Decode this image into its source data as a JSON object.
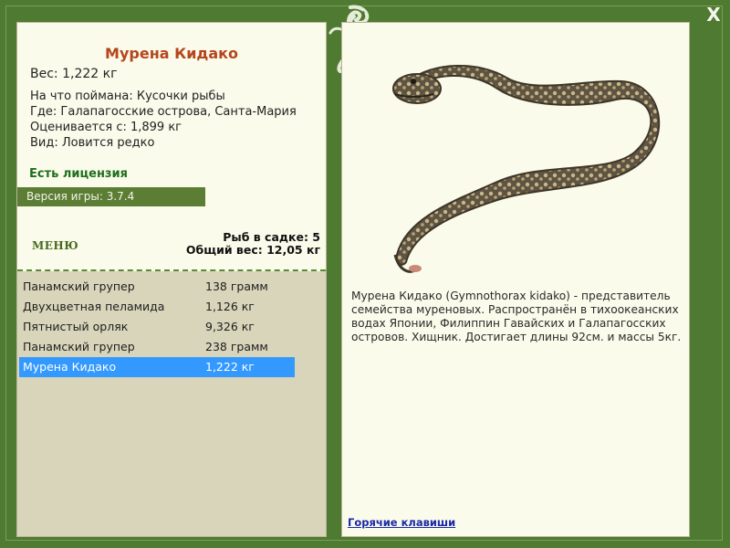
{
  "window": {
    "close_label": "X"
  },
  "fish": {
    "title": "Мурена Кидако",
    "weight_line": "Вес: 1,222 кг",
    "bait_line": "На что поймана: Кусочки рыбы",
    "location_line": "Где: Галапагосские острова, Санта-Мария",
    "rated_line": "Оценивается с: 1,899 кг",
    "kind_line": "Вид: Ловится редко",
    "description": "Мурена Кидако (Gymnothorax kidako) - представитель семейства муреновых. Распространён в тихоокеанских водах Японии, Филиппин Гавайских и Галапагосских островов. Хищник. Достигает длины 92см. и массы 5кг."
  },
  "license_label": "Есть лицензия",
  "version_label": "Версия игры: 3.7.4",
  "menu_label": "МЕНЮ",
  "keepnet": {
    "count_line": "Рыб в садке: 5",
    "total_line": "Общий вес: 12,05 кг"
  },
  "catch_list": [
    {
      "name": "Панамский групер",
      "weight": "138 грамм"
    },
    {
      "name": "Двухцветная пеламида",
      "weight": "1,126 кг"
    },
    {
      "name": "Пятнистый орляк",
      "weight": "9,326 кг"
    },
    {
      "name": "Панамский групер",
      "weight": "238 грамм"
    },
    {
      "name": "Мурена Кидако",
      "weight": "1,222 кг",
      "selected": true
    }
  ],
  "hotkeys_label": "Горячие клавиши",
  "colors": {
    "frame": "#4f7a31",
    "accent_green": "#5b7d34",
    "title": "#b5461c",
    "selection": "#3399ff",
    "link": "#1a28a8"
  },
  "icons": {
    "logo": "lizard-logo-icon",
    "close": "close-icon"
  }
}
